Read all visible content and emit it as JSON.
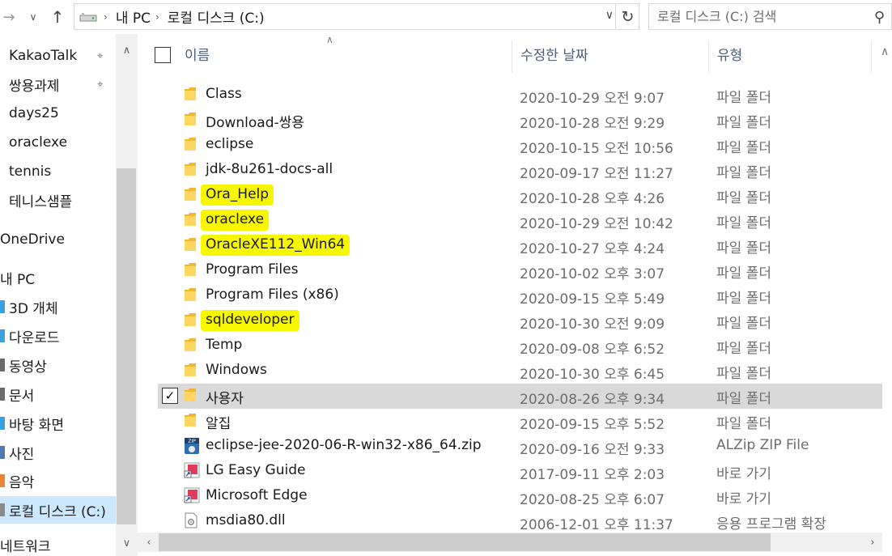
{
  "address": {
    "crumbs": [
      "내 PC",
      "로컬 디스크 (C:)"
    ],
    "search_placeholder": "로컬 디스크 (C:) 검색"
  },
  "nav": {
    "items": [
      {
        "label": "KakaoTalk",
        "pinned": true
      },
      {
        "label": "쌍용과제",
        "pinned": true
      },
      {
        "label": "days25",
        "pinned": false
      },
      {
        "label": "oraclexe",
        "pinned": false
      },
      {
        "label": "tennis",
        "pinned": false
      },
      {
        "label": "테니스샘플",
        "pinned": false
      },
      {
        "label": "OneDrive",
        "pinned": false
      },
      {
        "label": "내 PC",
        "pinned": false
      },
      {
        "label": "3D 개체",
        "pinned": false
      },
      {
        "label": "다운로드",
        "pinned": false
      },
      {
        "label": "동영상",
        "pinned": false
      },
      {
        "label": "문서",
        "pinned": false
      },
      {
        "label": "바탕 화면",
        "pinned": false
      },
      {
        "label": "사진",
        "pinned": false
      },
      {
        "label": "음악",
        "pinned": false
      },
      {
        "label": "로컬 디스크 (C:)",
        "pinned": false
      },
      {
        "label": "네트워크",
        "pinned": false
      }
    ]
  },
  "columns": {
    "name": "이름",
    "date": "수정한 날짜",
    "type": "유형"
  },
  "files": [
    {
      "name": "Class",
      "date": "2020-10-29 오전 9:07",
      "type": "파일 폴더",
      "icon": "folder-icon",
      "highlight": false,
      "selected": false
    },
    {
      "name": "Download-쌍용",
      "date": "2020-10-28 오전 9:29",
      "type": "파일 폴더",
      "icon": "folder-icon",
      "highlight": false,
      "selected": false
    },
    {
      "name": "eclipse",
      "date": "2020-10-15 오전 10:56",
      "type": "파일 폴더",
      "icon": "folder-icon",
      "highlight": false,
      "selected": false
    },
    {
      "name": "jdk-8u261-docs-all",
      "date": "2020-09-17 오전 11:27",
      "type": "파일 폴더",
      "icon": "folder-icon",
      "highlight": false,
      "selected": false
    },
    {
      "name": "Ora_Help",
      "date": "2020-10-28 오후 4:26",
      "type": "파일 폴더",
      "icon": "folder-icon",
      "highlight": true,
      "selected": false
    },
    {
      "name": "oraclexe",
      "date": "2020-10-29 오전 10:42",
      "type": "파일 폴더",
      "icon": "folder-icon",
      "highlight": true,
      "selected": false
    },
    {
      "name": "OracleXE112_Win64",
      "date": "2020-10-27 오후 4:24",
      "type": "파일 폴더",
      "icon": "folder-icon",
      "highlight": true,
      "selected": false
    },
    {
      "name": "Program Files",
      "date": "2020-10-02 오후 3:07",
      "type": "파일 폴더",
      "icon": "folder-icon",
      "highlight": false,
      "selected": false
    },
    {
      "name": "Program Files (x86)",
      "date": "2020-09-15 오후 5:49",
      "type": "파일 폴더",
      "icon": "folder-icon",
      "highlight": false,
      "selected": false
    },
    {
      "name": "sqldeveloper",
      "date": "2020-10-30 오전 9:09",
      "type": "파일 폴더",
      "icon": "folder-icon",
      "highlight": true,
      "selected": false
    },
    {
      "name": "Temp",
      "date": "2020-09-08 오후 6:52",
      "type": "파일 폴더",
      "icon": "folder-icon",
      "highlight": false,
      "selected": false
    },
    {
      "name": "Windows",
      "date": "2020-10-30 오후 6:45",
      "type": "파일 폴더",
      "icon": "folder-icon",
      "highlight": false,
      "selected": false
    },
    {
      "name": "사용자",
      "date": "2020-08-26 오후 9:34",
      "type": "파일 폴더",
      "icon": "folder-icon",
      "highlight": false,
      "selected": true
    },
    {
      "name": "알집",
      "date": "2020-09-15 오후 5:52",
      "type": "파일 폴더",
      "icon": "folder-icon",
      "highlight": false,
      "selected": false
    },
    {
      "name": "eclipse-jee-2020-06-R-win32-x86_64.zip",
      "date": "2020-09-16 오전 9:33",
      "type": "ALZip ZIP File",
      "icon": "zip-icon",
      "highlight": false,
      "selected": false
    },
    {
      "name": "LG Easy Guide",
      "date": "2017-09-11 오후 2:03",
      "type": "바로 가기",
      "icon": "shortcut-icon",
      "highlight": false,
      "selected": false
    },
    {
      "name": "Microsoft Edge",
      "date": "2020-08-25 오후 6:07",
      "type": "바로 가기",
      "icon": "shortcut-icon",
      "highlight": false,
      "selected": false
    },
    {
      "name": "msdia80.dll",
      "date": "2006-12-01 오후 11:37",
      "type": "응용 프로그램 확장",
      "icon": "dll-icon",
      "highlight": false,
      "selected": false
    }
  ],
  "colors": {
    "highlight": "#f6f700",
    "selected_row": "#d9d9d9",
    "nav_selected": "#cce8ff",
    "folder": "#f2b72a"
  }
}
